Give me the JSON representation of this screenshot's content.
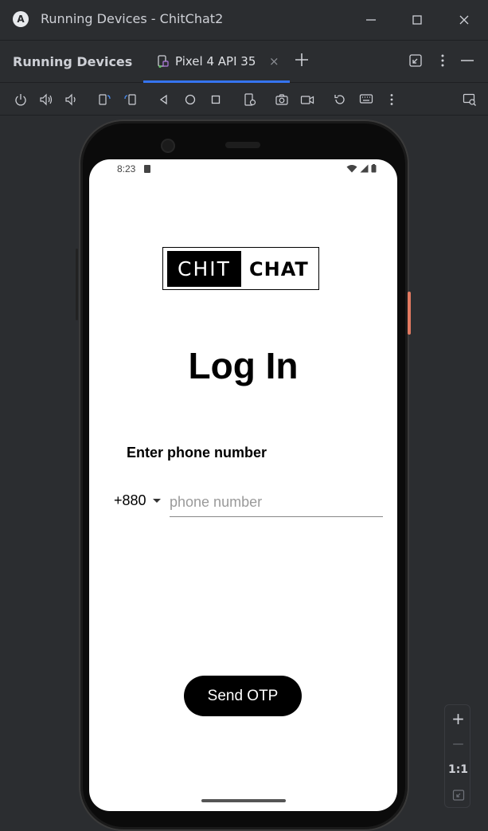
{
  "window": {
    "title": "Running Devices - ChitChat2",
    "logo_letter": "A"
  },
  "panel": {
    "title": "Running Devices",
    "tab_label": "Pixel 4 API 35",
    "tab_close": "×"
  },
  "device": {
    "status_time": "8:23",
    "logo_left": "CHIT",
    "logo_right": "CHAT",
    "page_title": "Log In",
    "phone_label": "Enter phone number",
    "country_code": "+880",
    "phone_placeholder": "phone number",
    "phone_value": "",
    "send_button": "Send OTP"
  },
  "zoom": {
    "zoom_in": "+",
    "zoom_out": "—",
    "actual_size": "1:1"
  },
  "colors": {
    "ide_bg": "#2b2d30",
    "accent": "#3574f0",
    "screen_bg": "#ffffff",
    "button_bg": "#000000"
  }
}
